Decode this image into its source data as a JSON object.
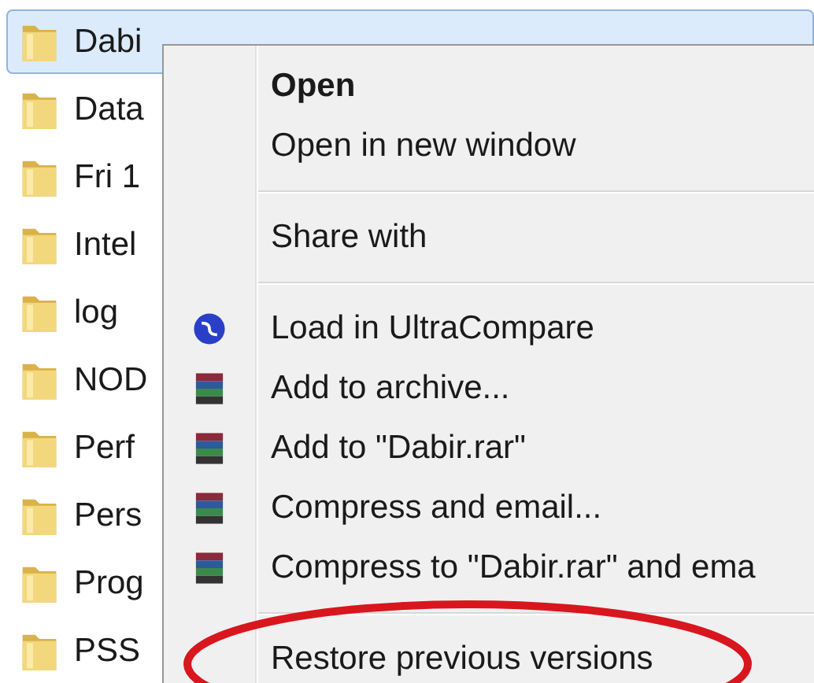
{
  "folders": [
    {
      "name": "Dabi",
      "selected": true
    },
    {
      "name": "Data",
      "selected": false
    },
    {
      "name": "Fri 1",
      "selected": false
    },
    {
      "name": "Intel",
      "selected": false
    },
    {
      "name": "log",
      "selected": false
    },
    {
      "name": "NOD",
      "selected": false
    },
    {
      "name": "Perf",
      "selected": false
    },
    {
      "name": "Pers",
      "selected": false
    },
    {
      "name": "Prog",
      "selected": false
    },
    {
      "name": "PSS",
      "selected": false
    }
  ],
  "context_menu": {
    "sections": [
      [
        {
          "label": "Open",
          "bold": true,
          "kind": "plain"
        },
        {
          "label": "Open in new window",
          "bold": false,
          "kind": "plain"
        }
      ],
      [
        {
          "label": "Share with",
          "bold": false,
          "kind": "plain"
        }
      ],
      [
        {
          "label": "Load in UltraCompare",
          "bold": false,
          "kind": "compare"
        },
        {
          "label": "Add to archive...",
          "bold": false,
          "kind": "archiver"
        },
        {
          "label": "Add to \"Dabir.rar\"",
          "bold": false,
          "kind": "archiver"
        },
        {
          "label": "Compress and email...",
          "bold": false,
          "kind": "archiver"
        },
        {
          "label": "Compress to \"Dabir.rar\" and ema",
          "bold": false,
          "kind": "archiver"
        }
      ],
      [
        {
          "label": "Restore previous versions",
          "bold": false,
          "kind": "plain",
          "circled": true
        }
      ]
    ]
  }
}
